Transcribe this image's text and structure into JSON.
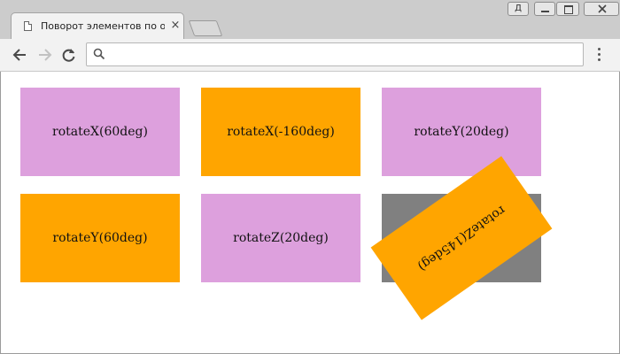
{
  "browser": {
    "tab_title": "Поворот элементов по оси",
    "tab_close": "×",
    "window_buttons": {
      "user": "Д"
    },
    "address": {
      "value": ""
    }
  },
  "demo": {
    "items": [
      {
        "label": "rotateX(60deg)",
        "color": "#dda0dd"
      },
      {
        "label": "rotateX(-160deg)",
        "color": "#ffa500"
      },
      {
        "label": "rotateY(20deg)",
        "color": "#dda0dd"
      },
      {
        "label": "rotateY(60deg)",
        "color": "#ffa500"
      },
      {
        "label": "rotateZ(20deg)",
        "color": "#dda0dd"
      },
      {
        "label": "rotateZ(145deg)",
        "color": "#ffa500",
        "holder_color": "#808080"
      }
    ]
  }
}
